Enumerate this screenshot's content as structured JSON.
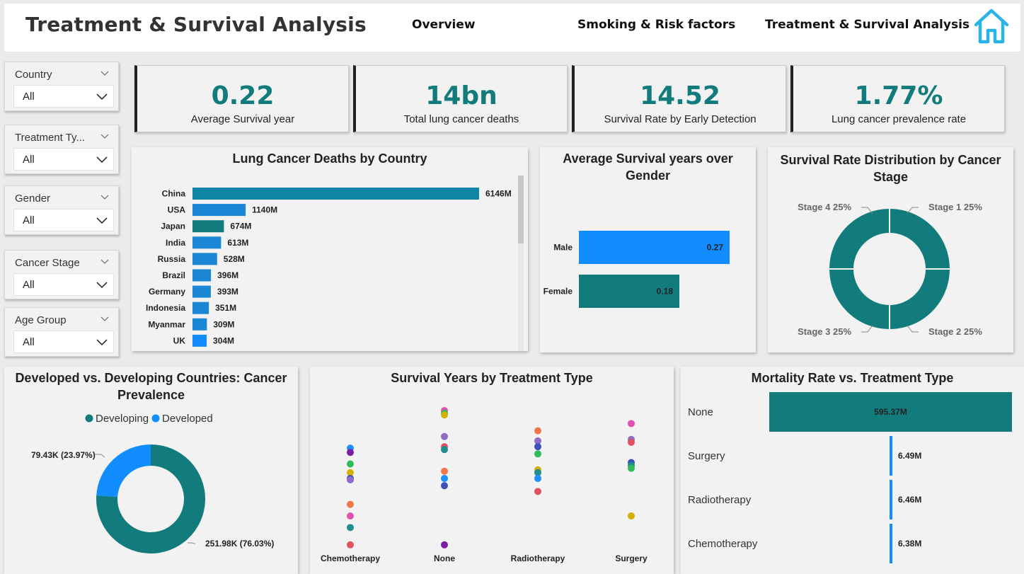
{
  "header": {
    "title": "Treatment & Survival Analysis",
    "nav": [
      "Overview",
      "Smoking & Risk factors",
      "Treatment & Survival Analysis"
    ]
  },
  "slicers": [
    {
      "title": "Country",
      "value": "All"
    },
    {
      "title": "Treatment Ty...",
      "value": "All"
    },
    {
      "title": "Gender",
      "value": "All"
    },
    {
      "title": "Cancer Stage",
      "value": "All"
    },
    {
      "title": "Age Group",
      "value": "All"
    }
  ],
  "kpis": [
    {
      "value": "0.22",
      "label": "Average Survival year"
    },
    {
      "value": "14bn",
      "label": "Total lung cancer deaths"
    },
    {
      "value": "14.52",
      "label": "Survival Rate by Early Detection"
    },
    {
      "value": "1.77%",
      "label": "Lung cancer prevalence rate"
    }
  ],
  "colors": {
    "teal": "#127b7b",
    "blue": "#118dff",
    "blue2": "#1a86d4",
    "accent_text": "#127b7b"
  },
  "chart_data": [
    {
      "id": "deaths_by_country",
      "type": "bar",
      "orientation": "horizontal",
      "title": "Lung Cancer Deaths by Country",
      "categories": [
        "China",
        "USA",
        "Japan",
        "India",
        "Russia",
        "Brazil",
        "Germany",
        "Indonesia",
        "Myanmar",
        "UK"
      ],
      "values": [
        6146,
        1140,
        674,
        613,
        528,
        396,
        393,
        351,
        309,
        304
      ],
      "labels": [
        "6146M",
        "1140M",
        "674M",
        "613M",
        "528M",
        "396M",
        "393M",
        "351M",
        "309M",
        "304M"
      ],
      "bar_colors": [
        "#0e86a6",
        "#1a86d4",
        "#127b7b",
        "#1a86d4",
        "#1a86d4",
        "#1a86d4",
        "#1a86d4",
        "#1a86d4",
        "#1a86d4",
        "#118dff"
      ]
    },
    {
      "id": "survival_by_gender",
      "type": "bar",
      "orientation": "horizontal",
      "title": "Average Survival years over Gender",
      "categories": [
        "Male",
        "Female"
      ],
      "values": [
        0.27,
        0.18
      ],
      "labels": [
        "0.27",
        "0.18"
      ],
      "bar_colors": [
        "#118dff",
        "#127b7b"
      ]
    },
    {
      "id": "survival_by_stage",
      "type": "pie",
      "donut": true,
      "title": "Survival Rate Distribution by Cancer Stage",
      "categories": [
        "Stage 1",
        "Stage 2",
        "Stage 3",
        "Stage 4"
      ],
      "values": [
        25,
        25,
        25,
        25
      ],
      "labels": [
        "Stage 1 25%",
        "Stage 2 25%",
        "Stage 3 25%",
        "Stage 4 25%"
      ],
      "color": "#127b7b"
    },
    {
      "id": "developed_vs_developing",
      "type": "pie",
      "donut": true,
      "title": "Developed vs. Developing Countries: Cancer Prevalence",
      "legend": [
        "Developing",
        "Developed"
      ],
      "categories": [
        "Developing",
        "Developed"
      ],
      "values": [
        251.98,
        79.43
      ],
      "labels": [
        "251.98K (76.03%)",
        "79.43K (23.97%)"
      ],
      "colors": [
        "#127b7b",
        "#118dff"
      ]
    },
    {
      "id": "survival_by_treatment",
      "type": "scatter",
      "title": "Survival Years by Treatment Type",
      "categories": [
        "Chemotherapy",
        "None",
        "Radiotherapy",
        "Surgery"
      ],
      "points": [
        {
          "x": "Chemotherapy",
          "y": 0.72,
          "c": "#1e90ff"
        },
        {
          "x": "Chemotherapy",
          "y": 0.69,
          "c": "#7b1fa2"
        },
        {
          "x": "Chemotherapy",
          "y": 0.61,
          "c": "#2ebd59"
        },
        {
          "x": "Chemotherapy",
          "y": 0.55,
          "c": "#d4b106"
        },
        {
          "x": "Chemotherapy",
          "y": 0.51,
          "c": "#3f51b5"
        },
        {
          "x": "Chemotherapy",
          "y": 0.5,
          "c": "#8e6cc8"
        },
        {
          "x": "Chemotherapy",
          "y": 0.33,
          "c": "#f07848"
        },
        {
          "x": "Chemotherapy",
          "y": 0.25,
          "c": "#e052b0"
        },
        {
          "x": "Chemotherapy",
          "y": 0.17,
          "c": "#218c8c"
        },
        {
          "x": "Chemotherapy",
          "y": 0.05,
          "c": "#e05260"
        },
        {
          "x": "None",
          "y": 0.98,
          "c": "#e052b0"
        },
        {
          "x": "None",
          "y": 0.96,
          "c": "#2ebd59"
        },
        {
          "x": "None",
          "y": 0.95,
          "c": "#d4b106"
        },
        {
          "x": "None",
          "y": 0.8,
          "c": "#8e6cc8"
        },
        {
          "x": "None",
          "y": 0.73,
          "c": "#e05260"
        },
        {
          "x": "None",
          "y": 0.71,
          "c": "#218c8c"
        },
        {
          "x": "None",
          "y": 0.56,
          "c": "#f07848"
        },
        {
          "x": "None",
          "y": 0.51,
          "c": "#1e90ff"
        },
        {
          "x": "None",
          "y": 0.46,
          "c": "#3f51b5"
        },
        {
          "x": "None",
          "y": 0.05,
          "c": "#7b1fa2"
        },
        {
          "x": "Radiotherapy",
          "y": 0.84,
          "c": "#f07848"
        },
        {
          "x": "Radiotherapy",
          "y": 0.77,
          "c": "#8e6cc8"
        },
        {
          "x": "Radiotherapy",
          "y": 0.73,
          "c": "#3f51b5"
        },
        {
          "x": "Radiotherapy",
          "y": 0.68,
          "c": "#2ebd59"
        },
        {
          "x": "Radiotherapy",
          "y": 0.57,
          "c": "#d4b106"
        },
        {
          "x": "Radiotherapy",
          "y": 0.55,
          "c": "#218c8c"
        },
        {
          "x": "Radiotherapy",
          "y": 0.51,
          "c": "#1e90ff"
        },
        {
          "x": "Radiotherapy",
          "y": 0.42,
          "c": "#e05260"
        },
        {
          "x": "Surgery",
          "y": 0.89,
          "c": "#e052b0"
        },
        {
          "x": "Surgery",
          "y": 0.78,
          "c": "#8e6cc8"
        },
        {
          "x": "Surgery",
          "y": 0.76,
          "c": "#e05260"
        },
        {
          "x": "Surgery",
          "y": 0.62,
          "c": "#3f51b5"
        },
        {
          "x": "Surgery",
          "y": 0.6,
          "c": "#218c8c"
        },
        {
          "x": "Surgery",
          "y": 0.58,
          "c": "#2ebd59"
        },
        {
          "x": "Surgery",
          "y": 0.25,
          "c": "#d4b106"
        }
      ]
    },
    {
      "id": "mortality_by_treatment",
      "type": "bar",
      "orientation": "horizontal",
      "title": "Mortality Rate vs. Treatment Type",
      "categories": [
        "None",
        "Surgery",
        "Radiotherapy",
        "Chemotherapy"
      ],
      "values": [
        595.37,
        6.49,
        6.46,
        6.38
      ],
      "labels": [
        "595.37M",
        "6.49M",
        "6.46M",
        "6.38M"
      ],
      "bar_colors": [
        "#127b7b",
        "#118dff",
        "#118dff",
        "#118dff"
      ]
    }
  ]
}
